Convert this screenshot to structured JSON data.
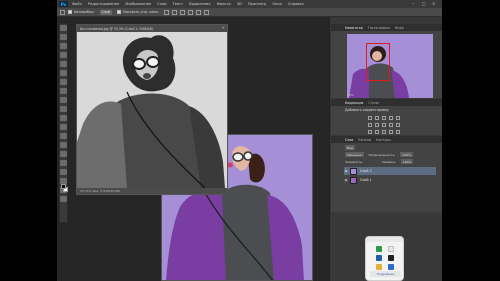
{
  "menubar": {
    "logo": "Ps",
    "items": [
      "Файл",
      "Редактирование",
      "Изображение",
      "Слои",
      "Текст",
      "Выделение",
      "Фильтр",
      "3D",
      "Просмотр",
      "Окно",
      "Справка"
    ],
    "window_controls": [
      "–",
      "□",
      "×"
    ]
  },
  "options": {
    "checkbox_label": "Автовыбор:",
    "select_value": "Слой",
    "transform_label": "Показать упр. элем."
  },
  "documents": {
    "doc1_title": "Без-названия.jpg @ 33,3% (Слой 2, RGB/8#)",
    "doc1_close": "×",
    "doc1_status": "33,33%  Док: 5,93М/10,5М"
  },
  "navigator": {
    "tabs": [
      "Навигатор",
      "Гистограмма",
      "Инфо"
    ],
    "zoom": "33%"
  },
  "adjustments": {
    "tabs": [
      "Коррекция",
      "Стили"
    ],
    "title": "Добавить корректировку"
  },
  "layers": {
    "tabs": [
      "Слои",
      "Каналы",
      "Контуры"
    ],
    "kind": "Вид",
    "blend_mode": "Обычные",
    "opacity_label": "Непрозрачность:",
    "opacity_value": "100%",
    "lock_label": "Закрепить:",
    "fill_label": "Заливка:",
    "fill_value": "100%",
    "items": [
      {
        "name": "Слой 2",
        "selected": true
      },
      {
        "name": "Слой 1",
        "selected": false
      }
    ]
  },
  "phone": {
    "button": "Подробнее"
  },
  "colors": {
    "ui_dark": "#262626",
    "purple_bg": "#a58fd7",
    "selection_blue": "#5c6d83",
    "navigator_red": "#e01b1b"
  }
}
